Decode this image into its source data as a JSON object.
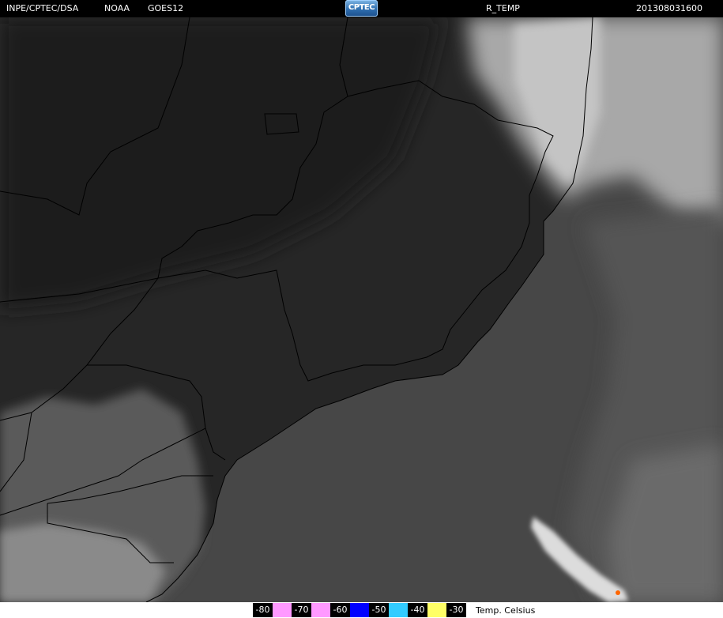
{
  "header": {
    "org": "INPE/CPTEC/DSA",
    "agency": "NOAA",
    "satellite": "GOES12",
    "logo_text": "CPTEC",
    "product": "R_TEMP",
    "timestamp": "201308031600"
  },
  "legend": {
    "items": [
      {
        "label": "-80",
        "color": "#ff99ff"
      },
      {
        "label": "-70",
        "color": "#ff99ff"
      },
      {
        "label": "-60",
        "color": "#0000ff"
      },
      {
        "label": "-50",
        "color": "#33ccff"
      },
      {
        "label": "-40",
        "color": "#ffff66"
      },
      {
        "label": "-30",
        "color": "#ff6600"
      }
    ],
    "unit": "Temp. Celsius"
  },
  "colors": {
    "land": "#262626",
    "ocean": "#474747",
    "cloud": "#b0b0b0",
    "border": "#000000"
  }
}
